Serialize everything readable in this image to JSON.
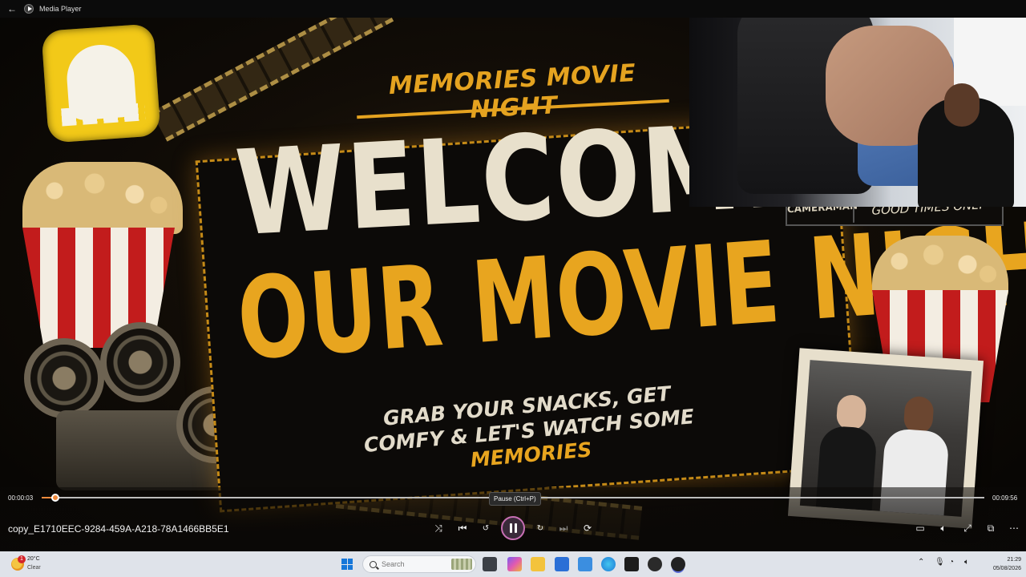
{
  "window": {
    "title": "Media Player"
  },
  "video": {
    "headline_top": "MEMORIES MOVIE NIGHT",
    "headline_line1": "WELCOME TO",
    "headline_line2": "OUR MOVIE NIGHT",
    "tagline_part1": "GRAB YOUR SNACKS, GET COMFY & LET'S WATCH SOME",
    "tagline_highlight": "MEMORIES",
    "tag_cameraman": "CAMERAMAN",
    "tag_goodtimes": "GOOD TIMES ONLY"
  },
  "player": {
    "current_time": "00:00:03",
    "duration": "00:09:56",
    "progress": 0.01,
    "tooltip": "Pause (Ctrl+P)",
    "filename": "copy_E1710EEC-9284-459A-A218-78A1466BB5E1",
    "accent_color": "#f08a3c",
    "icons": [
      "shuffle-icon",
      "previous-icon",
      "rewind-10-icon",
      "pause-icon",
      "forward-30-icon",
      "next-icon",
      "repeat-off-icon",
      "mini-player-icon",
      "volume-icon",
      "fullscreen-icon",
      "pip-icon",
      "more-icon"
    ]
  },
  "taskbar": {
    "weather": {
      "badge": "1",
      "temp": "20°C",
      "condition": "Clear"
    },
    "search_placeholder": "Search",
    "time": "21:29",
    "date": "05/08/2026"
  }
}
